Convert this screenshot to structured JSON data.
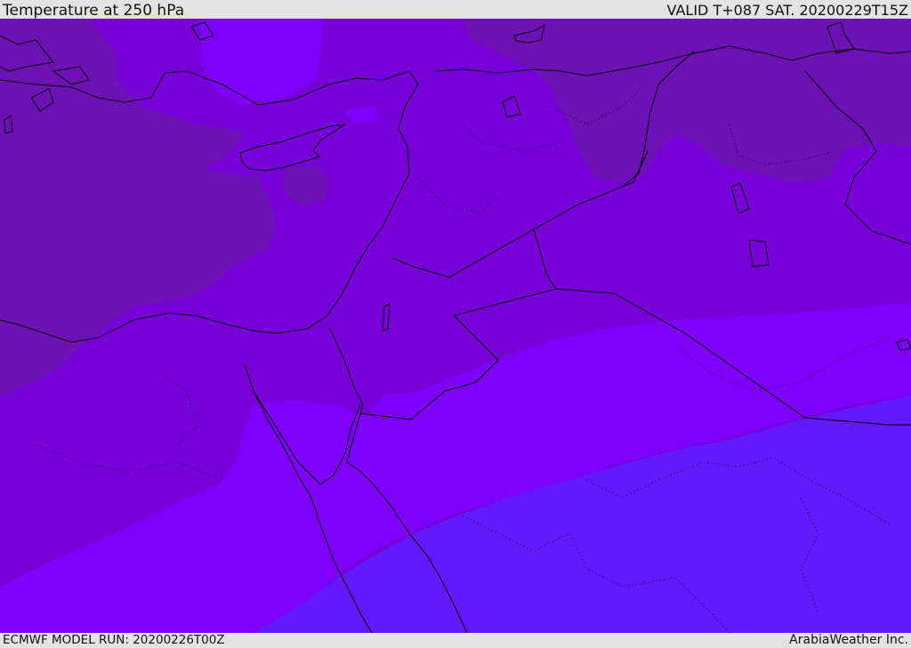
{
  "header": {
    "title": "Temperature at 250 hPa",
    "valid_time": "VALID T+087 SAT. 20200229T15Z"
  },
  "footer": {
    "model_run": "ECMWF MODEL RUN: 20200226T00Z",
    "credit": "ArabiaWeather Inc."
  },
  "colors": {
    "warmest_band": "#6c12b4",
    "warm_band": "#7700d8",
    "mid_band": "#7e00fc",
    "cool_band": "#6219fe",
    "coldest_band": "#5e22fe",
    "coastline": "#000000",
    "border": "#000000",
    "frame_background": "#e3e3e3"
  }
}
